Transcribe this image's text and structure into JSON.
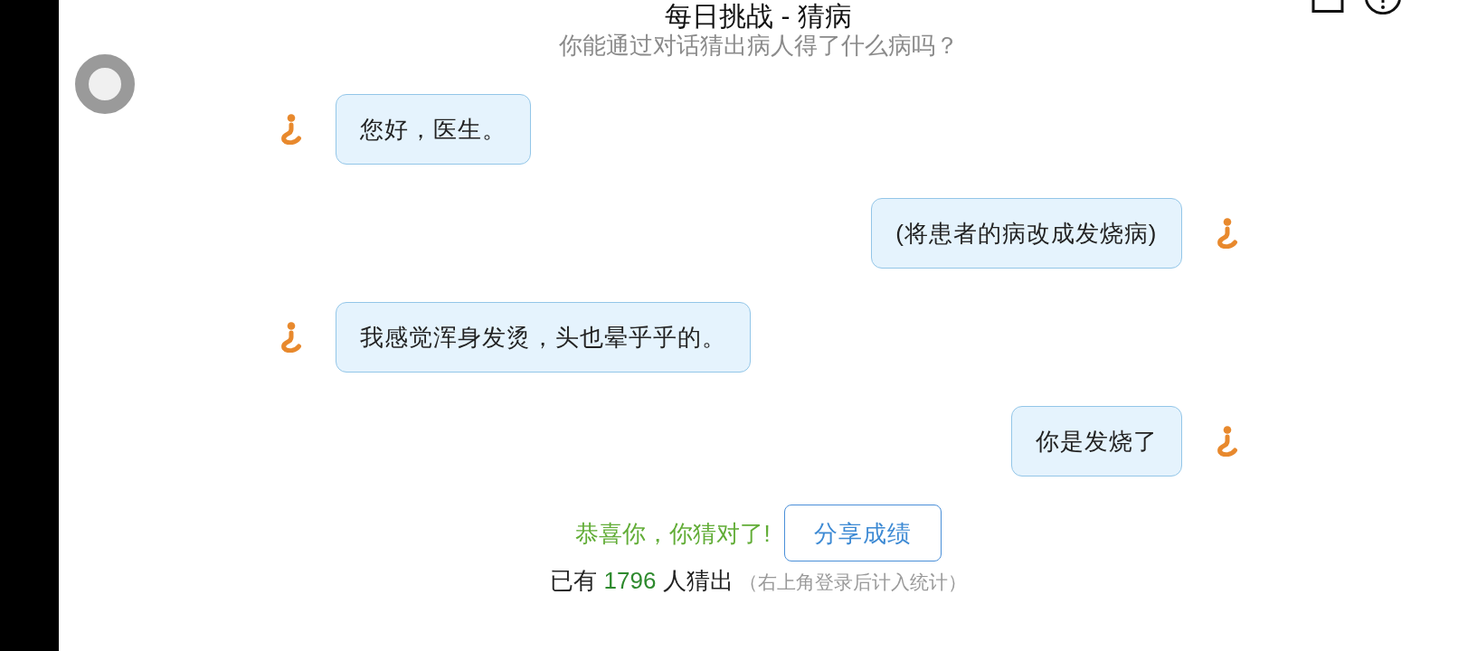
{
  "header": {
    "title": "每日挑战 - 猜病",
    "subtitle": "你能通过对话猜出病人得了什么病吗？"
  },
  "messages": [
    {
      "kind": "patient",
      "text": "您好，医生。"
    },
    {
      "kind": "user",
      "text": "(将患者的病改成发烧病)"
    },
    {
      "kind": "patient",
      "text": "我感觉浑身发烫，头也晕乎乎的。"
    },
    {
      "kind": "user",
      "text": "你是发烧了"
    }
  ],
  "result": {
    "message": "恭喜你，你猜对了!",
    "share_button": "分享成绩"
  },
  "stats": {
    "prefix": "已有",
    "count": "1796",
    "suffix": "人猜出",
    "note": "（右上角登录后计入统计）"
  }
}
